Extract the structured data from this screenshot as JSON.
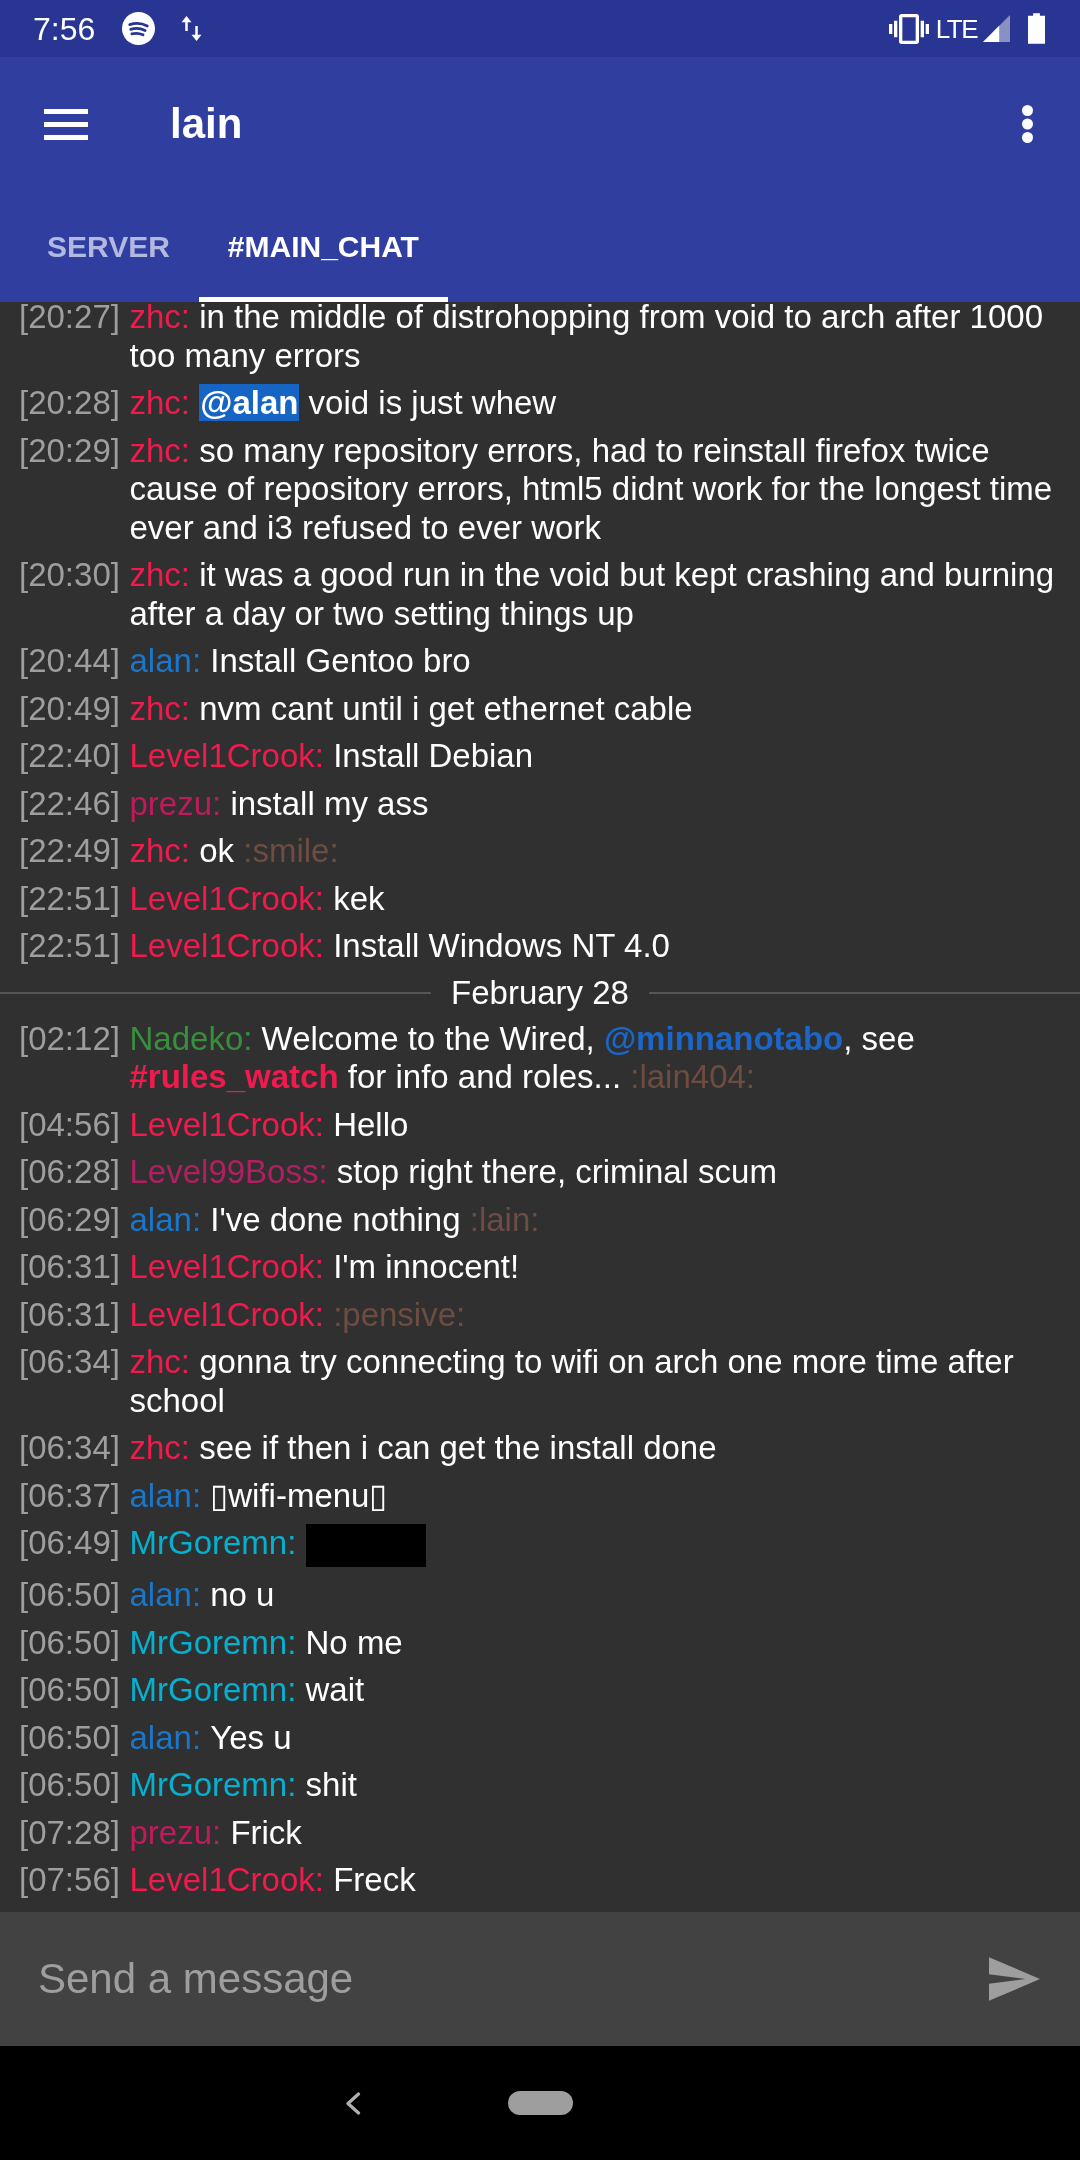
{
  "status_bar": {
    "time": "7:56",
    "network": "LTE"
  },
  "toolbar": {
    "title": "lain"
  },
  "tabs": [
    {
      "label": "SERVER",
      "selected": false
    },
    {
      "label": "#MAIN_CHAT",
      "selected": true
    }
  ],
  "messages": [
    {
      "kind": "message",
      "time": "[20:27]",
      "nick": "zhc:",
      "color": "#f01a4d",
      "parts": [
        {
          "kind": "text",
          "text": "in the middle of distrohopping from void to arch after 1000 too many errors"
        }
      ]
    },
    {
      "kind": "message",
      "time": "[20:28]",
      "nick": "zhc:",
      "color": "#f01a4d",
      "parts": [
        {
          "kind": "highlight",
          "text": "@alan"
        },
        {
          "kind": "text",
          "text": " void is just whew"
        }
      ]
    },
    {
      "kind": "message",
      "time": "[20:29]",
      "nick": "zhc:",
      "color": "#f01a4d",
      "parts": [
        {
          "kind": "text",
          "text": "so many repository errors, had to reinstall firefox twice cause of repository errors, html5 didnt work for the longest time ever and i3 refused to ever work"
        }
      ]
    },
    {
      "kind": "message",
      "time": "[20:30]",
      "nick": "zhc:",
      "color": "#f01a4d",
      "parts": [
        {
          "kind": "text",
          "text": "it was a good run in the void but kept crashing and burning after a day or two setting things up"
        }
      ]
    },
    {
      "kind": "message",
      "time": "[20:44]",
      "nick": "alan:",
      "color": "#1a76c8",
      "parts": [
        {
          "kind": "text",
          "text": "Install Gentoo bro"
        }
      ]
    },
    {
      "kind": "message",
      "time": "[20:49]",
      "nick": "zhc:",
      "color": "#f01a4d",
      "parts": [
        {
          "kind": "text",
          "text": "nvm cant until i get ethernet cable"
        }
      ]
    },
    {
      "kind": "message",
      "time": "[22:40]",
      "nick": "Level1Crook:",
      "color": "#f01a4d",
      "parts": [
        {
          "kind": "text",
          "text": "Install Debian"
        }
      ]
    },
    {
      "kind": "message",
      "time": "[22:46]",
      "nick": "prezu:",
      "color": "#bf1a5c",
      "parts": [
        {
          "kind": "text",
          "text": "install my ass"
        }
      ]
    },
    {
      "kind": "message",
      "time": "[22:49]",
      "nick": "zhc:",
      "color": "#f01a4d",
      "parts": [
        {
          "kind": "text",
          "text": "ok "
        },
        {
          "kind": "emote",
          "text": ":smile:"
        }
      ]
    },
    {
      "kind": "message",
      "time": "[22:51]",
      "nick": "Level1Crook:",
      "color": "#f01a4d",
      "parts": [
        {
          "kind": "text",
          "text": "kek"
        }
      ]
    },
    {
      "kind": "message",
      "time": "[22:51]",
      "nick": "Level1Crook:",
      "color": "#f01a4d",
      "parts": [
        {
          "kind": "text",
          "text": "Install Windows NT 4.0"
        }
      ]
    },
    {
      "kind": "date",
      "text": "February 28"
    },
    {
      "kind": "message",
      "time": "[02:12]",
      "nick": "Nadeko:",
      "color": "#388e3c",
      "parts": [
        {
          "kind": "text",
          "text": "Welcome to the Wired, "
        },
        {
          "kind": "mention",
          "text": "@minnanotabo"
        },
        {
          "kind": "text",
          "text": ", see "
        },
        {
          "kind": "channel",
          "text": "#rules_watch"
        },
        {
          "kind": "text",
          "text": " for info and roles... "
        },
        {
          "kind": "emote",
          "text": ":lain404:"
        }
      ]
    },
    {
      "kind": "message",
      "time": "[04:56]",
      "nick": "Level1Crook:",
      "color": "#f01a4d",
      "parts": [
        {
          "kind": "text",
          "text": "Hello"
        }
      ]
    },
    {
      "kind": "message",
      "time": "[06:28]",
      "nick": "Level99Boss:",
      "color": "#ad2160",
      "parts": [
        {
          "kind": "text",
          "text": "stop right there, criminal scum"
        }
      ]
    },
    {
      "kind": "message",
      "time": "[06:29]",
      "nick": "alan:",
      "color": "#1a76c8",
      "parts": [
        {
          "kind": "text",
          "text": "I've done nothing "
        },
        {
          "kind": "emote",
          "text": ":lain:"
        }
      ]
    },
    {
      "kind": "message",
      "time": "[06:31]",
      "nick": "Level1Crook:",
      "color": "#f01a4d",
      "parts": [
        {
          "kind": "text",
          "text": "I'm innocent!"
        }
      ]
    },
    {
      "kind": "message",
      "time": "[06:31]",
      "nick": "Level1Crook:",
      "color": "#f01a4d",
      "parts": [
        {
          "kind": "emote",
          "text": ":pensive:"
        }
      ]
    },
    {
      "kind": "message",
      "time": "[06:34]",
      "nick": "zhc:",
      "color": "#f01a4d",
      "parts": [
        {
          "kind": "text",
          "text": "gonna try connecting to wifi on arch one more time after school"
        }
      ]
    },
    {
      "kind": "message",
      "time": "[06:34]",
      "nick": "zhc:",
      "color": "#f01a4d",
      "parts": [
        {
          "kind": "text",
          "text": "see if then i can get the install done"
        }
      ]
    },
    {
      "kind": "message",
      "time": "[06:37]",
      "nick": "alan:",
      "color": "#1a76c8",
      "parts": [
        {
          "kind": "text",
          "text": "▯wifi-menu▯"
        }
      ]
    },
    {
      "kind": "message",
      "time": "[06:49]",
      "nick": "MrGoremn:",
      "color": "#06b0cf",
      "parts": [
        {
          "kind": "spoiler"
        }
      ]
    },
    {
      "kind": "message",
      "time": "[06:50]",
      "nick": "alan:",
      "color": "#1a76c8",
      "parts": [
        {
          "kind": "text",
          "text": "no u"
        }
      ]
    },
    {
      "kind": "message",
      "time": "[06:50]",
      "nick": "MrGoremn:",
      "color": "#06b0cf",
      "parts": [
        {
          "kind": "text",
          "text": "No me"
        }
      ]
    },
    {
      "kind": "message",
      "time": "[06:50]",
      "nick": "MrGoremn:",
      "color": "#06b0cf",
      "parts": [
        {
          "kind": "text",
          "text": "wait"
        }
      ]
    },
    {
      "kind": "message",
      "time": "[06:50]",
      "nick": "alan:",
      "color": "#1a76c8",
      "parts": [
        {
          "kind": "text",
          "text": "Yes u"
        }
      ]
    },
    {
      "kind": "message",
      "time": "[06:50]",
      "nick": "MrGoremn:",
      "color": "#06b0cf",
      "parts": [
        {
          "kind": "text",
          "text": "shit"
        }
      ]
    },
    {
      "kind": "message",
      "time": "[07:28]",
      "nick": "prezu:",
      "color": "#bf1a5c",
      "parts": [
        {
          "kind": "text",
          "text": "Frick"
        }
      ]
    },
    {
      "kind": "message",
      "time": "[07:56]",
      "nick": "Level1Crook:",
      "color": "#f01a4d",
      "parts": [
        {
          "kind": "text",
          "text": "Freck"
        }
      ]
    }
  ],
  "composer": {
    "placeholder": "Send a message"
  }
}
